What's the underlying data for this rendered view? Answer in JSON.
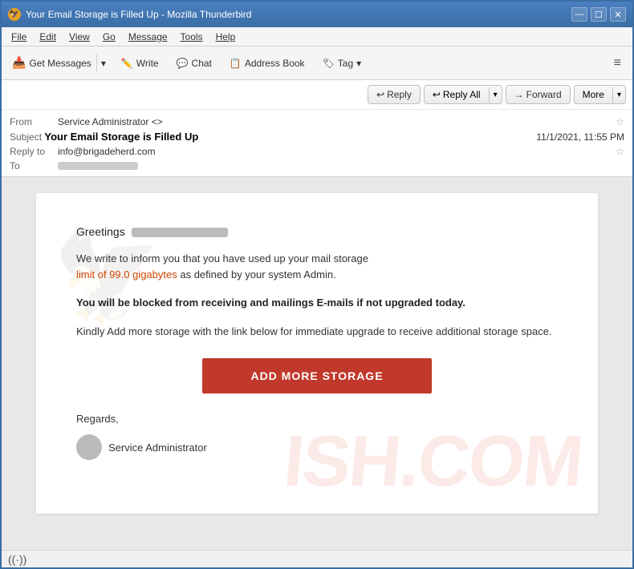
{
  "window": {
    "title": "Your Email Storage is Filled Up - Mozilla Thunderbird",
    "icon": "🦅"
  },
  "title_controls": {
    "minimize": "—",
    "maximize": "☐",
    "close": "✕"
  },
  "menu": {
    "items": [
      "File",
      "Edit",
      "View",
      "Go",
      "Message",
      "Tools",
      "Help"
    ]
  },
  "toolbar": {
    "get_messages": "Get Messages",
    "write": "Write",
    "chat": "Chat",
    "address_book": "Address Book",
    "tag": "Tag",
    "hamburger": "≡"
  },
  "action_bar": {
    "reply": "Reply",
    "reply_all": "Reply All",
    "forward": "Forward",
    "more": "More"
  },
  "email": {
    "from_label": "From",
    "from_value": "Service Administrator <>",
    "subject_label": "Subject",
    "subject_value": "Your Email Storage is Filled Up",
    "date_value": "11/1/2021, 11:55 PM",
    "reply_to_label": "Reply to",
    "reply_to_value": "info@brigadeherd.com",
    "to_label": "To"
  },
  "body": {
    "greeting": "Greetings",
    "paragraph1_pre": "We write to inform you that you have used up your mail storage",
    "paragraph1_highlight": "limit of 99.0 gigabytes",
    "paragraph1_post": "as defined by your system Admin.",
    "paragraph2": "You will be blocked from receiving and mailings E-mails if not upgraded today.",
    "paragraph3": "Kindly Add more storage with the link below for immediate upgrade to receive additional storage space.",
    "cta_label": "ADD MORE STORAGE",
    "regards": "Regards,",
    "sender_name": "Service Administrator"
  },
  "watermark_text": "ISH.COM",
  "status_bar": {
    "wifi_icon": "((·))"
  }
}
